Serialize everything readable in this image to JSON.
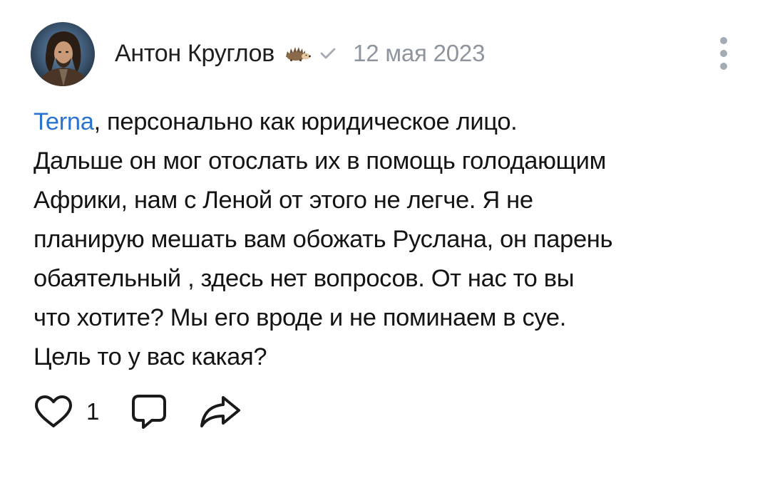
{
  "comment": {
    "author": "Антон Круглов",
    "author_badge": "hedgehog-icon",
    "verified_icon": "checkmark-icon",
    "date": "12 мая 2023",
    "mention": "Terna",
    "lines": [
      ", персонально как юридическое лицо.",
      "Дальше он мог отослать их в помощь голодающим",
      "Африки, нам с Леной от этого не легче. Я не",
      "планирую мешать вам обожать Руслана, он парень",
      "обаятельный , здесь нет вопросов. От нас то вы",
      "что хотите? Мы его вроде и не поминаем в суе.",
      "Цель то у вас какая?"
    ],
    "actions": {
      "like_icon": "heart-icon",
      "like_count": "1",
      "reply_icon": "comment-bubble-icon",
      "share_icon": "share-arrow-icon"
    },
    "menu_icon": "more-vertical-icon"
  },
  "colors": {
    "mention": "#2a74d0",
    "date": "#8e959e",
    "icon": "#a3abb5",
    "text": "#141414"
  }
}
